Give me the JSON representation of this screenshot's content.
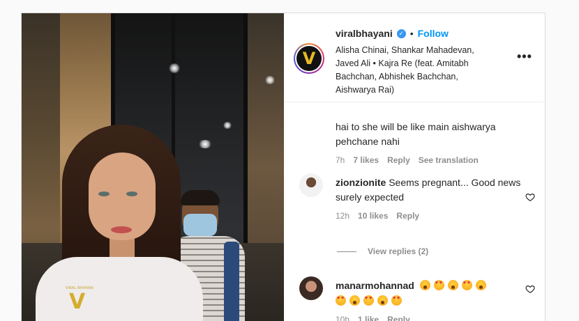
{
  "post": {
    "username": "viralbhayani",
    "separator": "•",
    "follow_label": "Follow",
    "audio": "Alisha Chinai, Shankar Mahadevan, Javed Ali • Kajra Re (feat. Amitabh Bachchan, Abhishek Bachchan, Aishwarya Rai)",
    "more_label": "•••",
    "avatar_glyph": "V",
    "watermark_text": "VIRAL BHAYANI",
    "watermark_glyph": "V"
  },
  "comments": [
    {
      "text": "hai to she will be like main aishwarya pehchane nahi",
      "time": "7h",
      "likes": "7 likes",
      "reply_label": "Reply",
      "translate_label": "See translation"
    },
    {
      "username": "zionzionite",
      "text": "Seems pregnant... Good news surely expected",
      "time": "12h",
      "likes": "10 likes",
      "reply_label": "Reply",
      "view_replies": "View replies (2)"
    },
    {
      "username": "manarmohannad",
      "emojis_row1": [
        "wow",
        "love",
        "wow",
        "love",
        "wow"
      ],
      "emojis_row2": [
        "love",
        "wow",
        "love",
        "wow",
        "love"
      ],
      "time": "10h",
      "likes": "1 like",
      "reply_label": "Reply"
    }
  ],
  "colors": {
    "link_blue": "#0095f6",
    "verified_blue": "#3897f0",
    "text_primary": "#262626",
    "text_secondary": "#8e8e8e"
  }
}
